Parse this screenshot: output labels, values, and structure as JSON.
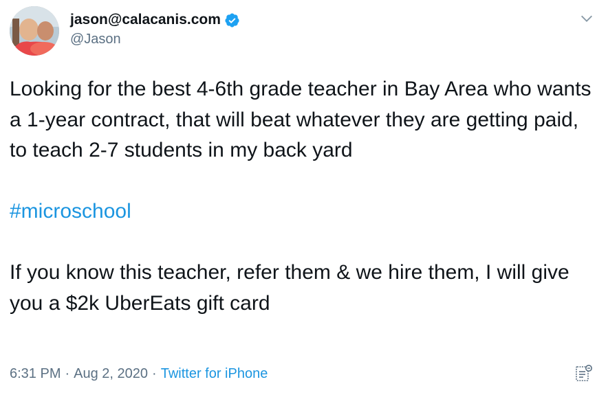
{
  "tweet": {
    "display_name": "jason@calacanis.com",
    "handle": "@Jason",
    "text_line_1": "Looking for the best 4-6th grade teacher in Bay Area who wants a 1-year contract, that will beat whatever they are getting paid, to teach 2-7 students in my back yard",
    "hashtag": "#microschool",
    "text_line_2": "If you know this teacher, refer them & we hire them, I will give you a $2k UberEats gift card",
    "time": "6:31 PM",
    "date": "Aug 2, 2020",
    "source": "Twitter for iPhone",
    "separator": "·"
  },
  "colors": {
    "link": "#1b95e0",
    "muted": "#5b7083",
    "verified": "#1da1f2"
  },
  "icons": {
    "verified": "verified-badge-icon",
    "caret": "chevron-down-icon",
    "analytics": "analytics-icon"
  }
}
